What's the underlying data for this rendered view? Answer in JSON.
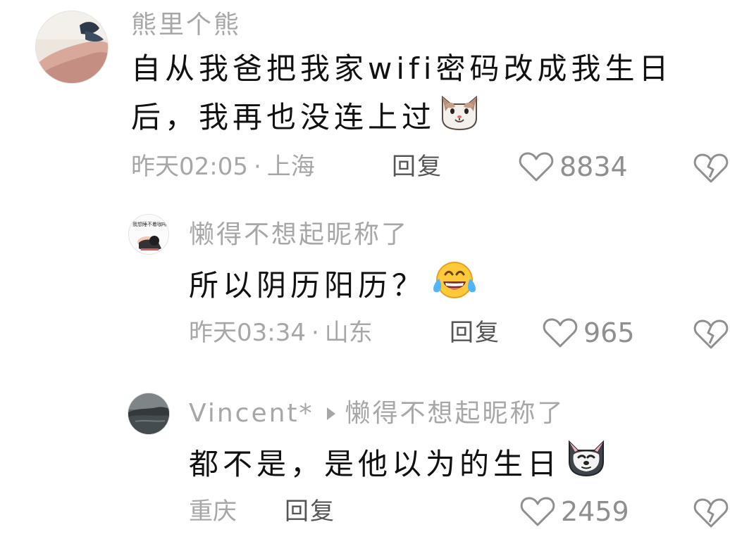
{
  "comments": [
    {
      "author": "熊里个熊",
      "text_line1": "自从我爸把我家wifi密码改成我生日",
      "text_line2": "后，我再也没连上过",
      "time": "昨天02:05",
      "location": "上海",
      "reply_label": "回复",
      "likes": "8834",
      "emoji_icon": "cat-face-icon"
    },
    {
      "author": "懒得不想起昵称了",
      "avatar_text": "我想睡不着咖啡",
      "text": "所以阴历阳历？",
      "time": "昨天03:34",
      "location": "山东",
      "reply_label": "回复",
      "likes": "965",
      "emoji_icon": "laughing-crying-face-icon"
    },
    {
      "author": "Vincent*",
      "reply_to": "懒得不想起昵称了",
      "text": "都不是，是他以为的生日",
      "location": "重庆",
      "reply_label": "回复",
      "likes": "2459",
      "emoji_icon": "doge-face-icon"
    }
  ],
  "icons": {
    "like": "heart-outline-icon",
    "dislike": "broken-heart-icon"
  },
  "colors": {
    "text": "#111111",
    "secondary": "#a7a7a7",
    "reply": "#555555",
    "icon": "#8f8f8f",
    "background": "#ffffff"
  }
}
